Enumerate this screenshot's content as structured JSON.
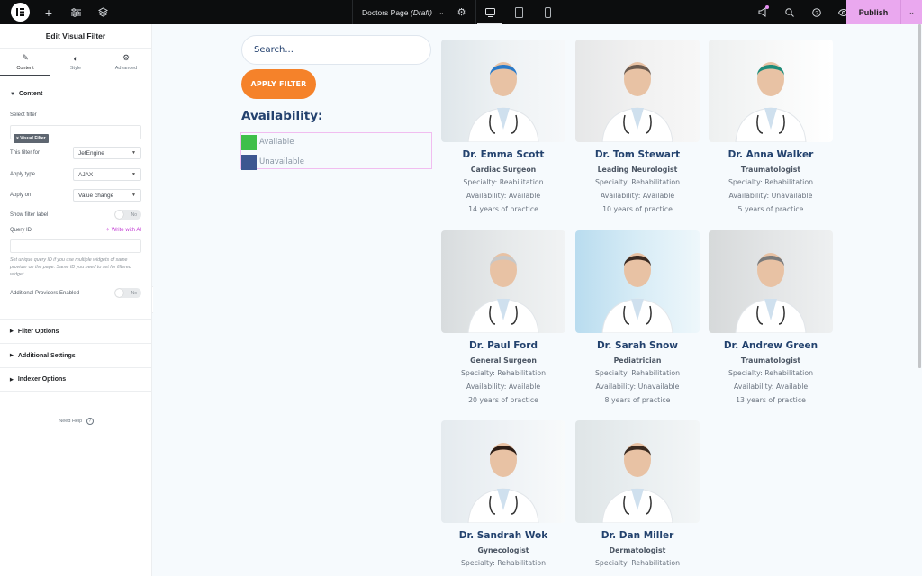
{
  "topbar": {
    "left_icons": [
      "elementor-logo-icon",
      "add-icon",
      "settings-sliders-icon",
      "layers-icon"
    ],
    "doc_title": "Doctors Page",
    "doc_status": "(Draft)",
    "devices": [
      {
        "name": "desktop",
        "active": true
      },
      {
        "name": "tablet",
        "active": false
      },
      {
        "name": "mobile",
        "active": false
      }
    ],
    "right_icons": [
      "notifications-megaphone-icon",
      "search-icon",
      "help-icon",
      "preview-eye-icon"
    ],
    "publish_label": "Publish",
    "accent": "#eaa8ef"
  },
  "panel": {
    "title": "Edit Visual Filter",
    "tabs": [
      {
        "label": "Content",
        "icon": "pencil-icon",
        "active": true
      },
      {
        "label": "Style",
        "icon": "contrast-icon",
        "active": false
      },
      {
        "label": "Advanced",
        "icon": "gear-icon",
        "active": false
      }
    ],
    "content_section": "Content",
    "select_filter_label": "Select filter",
    "selected_filter_chip": "× Visual Filter",
    "this_filter_for_label": "This filter for",
    "this_filter_for_value": "JetEngine",
    "apply_type_label": "Apply type",
    "apply_type_value": "AJAX",
    "apply_on_label": "Apply on",
    "apply_on_value": "Value change",
    "show_filter_label_label": "Show filter label",
    "show_filter_label_value": "No",
    "query_id_label": "Query ID",
    "write_with_ai": "✧ Write with AI",
    "query_id_value": "",
    "query_id_help": "Set unique query ID if you use multiple widgets of same provider on the page. Same ID you need to set for filtered widget.",
    "additional_providers_label": "Additional Providers Enabled",
    "additional_providers_value": "No",
    "collapsed_sections": [
      "Filter Options",
      "Additional Settings",
      "Indexer Options"
    ],
    "need_help": "Need Help"
  },
  "canvas": {
    "search_placeholder": "Search...",
    "apply_filter_label": "APPLY FILTER",
    "availability_title": "Availability:",
    "availability_options": [
      {
        "label": "Available",
        "color": "#3fbf4a"
      },
      {
        "label": "Unavailable",
        "color": "#3d5791"
      }
    ],
    "doctors": [
      {
        "name": "Dr. Emma Scott",
        "role": "Cardiac Surgeon",
        "specialty": "Specialty: Reabilitation",
        "availability": "Availability: Available",
        "experience": "14 years of practice"
      },
      {
        "name": "Dr. Tom Stewart",
        "role": "Leading Neurologist",
        "specialty": "Specialty: Rehabilitation",
        "availability": "Availability: Available",
        "experience": "10 years of practice"
      },
      {
        "name": "Dr. Anna Walker",
        "role": "Traumatologist",
        "specialty": "Specialty: Rehabilitation",
        "availability": "Availability: Unavailable",
        "experience": "5 years of practice"
      },
      {
        "name": "Dr. Paul Ford",
        "role": "General Surgeon",
        "specialty": "Specialty: Rehabilitation",
        "availability": "Availability: Available",
        "experience": "20 years of practice"
      },
      {
        "name": "Dr. Sarah Snow",
        "role": "Pediatrician",
        "specialty": "Specialty: Rehabilitation",
        "availability": "Availability: Unavailable",
        "experience": "8 years of practice"
      },
      {
        "name": "Dr. Andrew Green",
        "role": "Traumatologist",
        "specialty": "Specialty: Rehabilitation",
        "availability": "Availability: Available",
        "experience": "13 years of practice"
      },
      {
        "name": "Dr. Sandrah Wok",
        "role": "Gynecologist",
        "specialty": "Specialty: Rehabilitation",
        "availability": "",
        "experience": ""
      },
      {
        "name": "Dr. Dan Miller",
        "role": "Dermatologist",
        "specialty": "Specialty: Rehabilitation",
        "availability": "",
        "experience": ""
      }
    ]
  }
}
